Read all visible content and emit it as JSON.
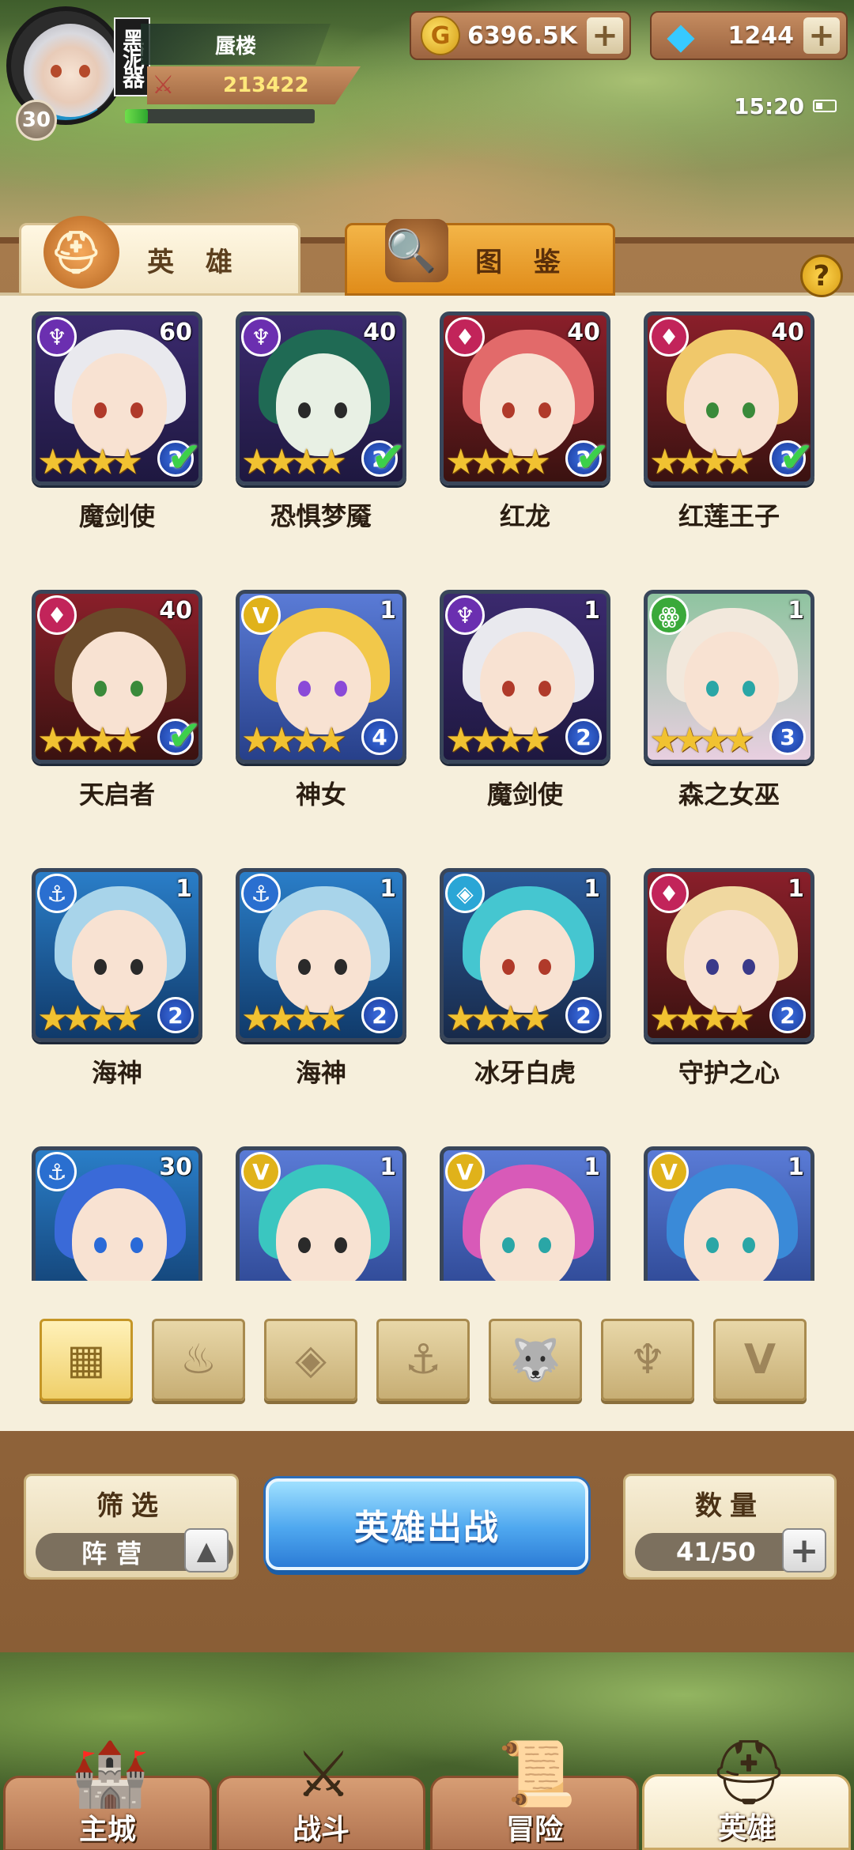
{
  "player": {
    "name": "蜃楼",
    "level": "30",
    "guild_tag": "黑泥器",
    "power": "213422",
    "exp_fraction": 0.12
  },
  "currencies": {
    "gold": "6396.5K",
    "gems": "1244"
  },
  "status": {
    "time": "15:20"
  },
  "tabs": {
    "heroes": "英 雄",
    "gallery": "图 鉴"
  },
  "help_label": "?",
  "heroes": [
    {
      "name": "魔剑使",
      "level": "60",
      "rank": "2",
      "deployed": true,
      "faction": "shadow"
    },
    {
      "name": "恐惧梦魇",
      "level": "40",
      "rank": "2",
      "deployed": true,
      "faction": "shadow"
    },
    {
      "name": "红龙",
      "level": "40",
      "rank": "2",
      "deployed": true,
      "faction": "fire"
    },
    {
      "name": "红莲王子",
      "level": "40",
      "rank": "2",
      "deployed": true,
      "faction": "fire"
    },
    {
      "name": "天启者",
      "level": "40",
      "rank": "3",
      "deployed": true,
      "faction": "fire"
    },
    {
      "name": "神女",
      "level": "1",
      "rank": "4",
      "deployed": false,
      "faction": "light"
    },
    {
      "name": "魔剑使",
      "level": "1",
      "rank": "2",
      "deployed": false,
      "faction": "shadow"
    },
    {
      "name": "森之女巫",
      "level": "1",
      "rank": "3",
      "deployed": false,
      "faction": "beast"
    },
    {
      "name": "海神",
      "level": "1",
      "rank": "2",
      "deployed": false,
      "faction": "sea"
    },
    {
      "name": "海神",
      "level": "1",
      "rank": "2",
      "deployed": false,
      "faction": "sea"
    },
    {
      "name": "冰牙白虎",
      "level": "1",
      "rank": "2",
      "deployed": false,
      "faction": "ice"
    },
    {
      "name": "守护之心",
      "level": "1",
      "rank": "2",
      "deployed": false,
      "faction": "fire"
    },
    {
      "name": "",
      "level": "30",
      "rank": "",
      "deployed": false,
      "faction": "sea"
    },
    {
      "name": "",
      "level": "1",
      "rank": "",
      "deployed": false,
      "faction": "light"
    },
    {
      "name": "",
      "level": "1",
      "rank": "",
      "deployed": false,
      "faction": "light"
    },
    {
      "name": "",
      "level": "1",
      "rank": "",
      "deployed": false,
      "faction": "light"
    }
  ],
  "faction_filters": [
    {
      "icon": "grid-all-icon",
      "active": true
    },
    {
      "icon": "fire-faction-icon",
      "active": false
    },
    {
      "icon": "ice-faction-icon",
      "active": false
    },
    {
      "icon": "anchor-faction-icon",
      "active": false
    },
    {
      "icon": "beast-faction-icon",
      "active": false
    },
    {
      "icon": "shadow-faction-icon",
      "active": false
    },
    {
      "icon": "light-faction-icon",
      "active": false
    }
  ],
  "filter": {
    "title": "筛选",
    "value": "阵营"
  },
  "deploy_button": "英雄出战",
  "count": {
    "title": "数量",
    "value": "41/50"
  },
  "nav": [
    {
      "label": "主城",
      "icon": "castle-icon"
    },
    {
      "label": "战斗",
      "icon": "crossed-swords-icon"
    },
    {
      "label": "冒险",
      "icon": "scroll-map-icon"
    },
    {
      "label": "英雄",
      "icon": "hero-helmet-icon"
    }
  ],
  "colors": {
    "shadow": "#6b2fb0",
    "fire": "#c2245a",
    "light": "#e0b21a",
    "beast": "#3aa93a",
    "sea": "#2a6fd0",
    "ice": "#2aa6d6"
  }
}
